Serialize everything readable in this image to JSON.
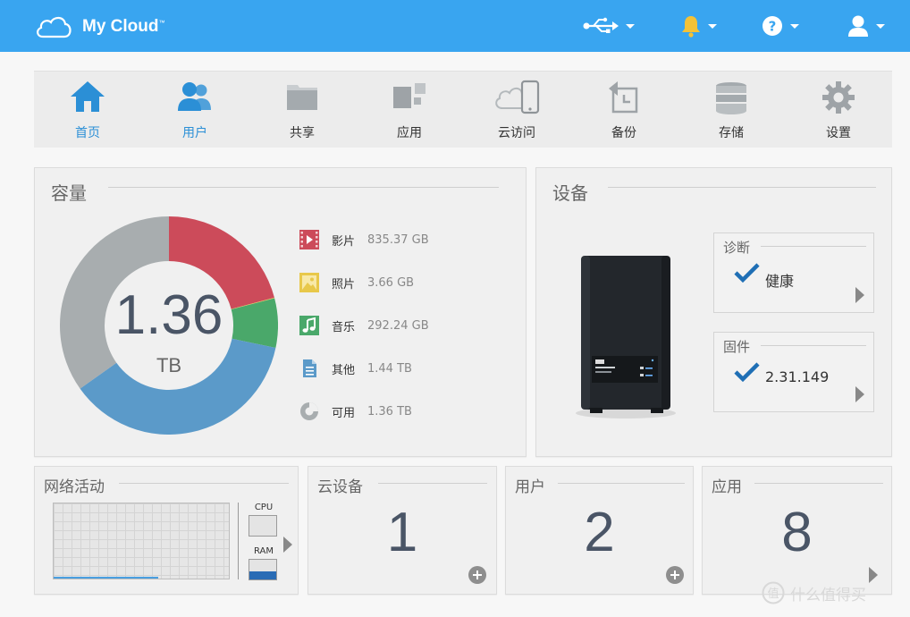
{
  "app": {
    "brand": "My Cloud",
    "trademark": "™"
  },
  "header": {
    "icons": [
      "usb-icon",
      "bell-icon",
      "help-icon",
      "user-icon"
    ],
    "colors": {
      "bar": "#39a5f0",
      "bell": "#f3c237"
    }
  },
  "nav": [
    {
      "label": "首页",
      "icon": "home-icon",
      "active": true
    },
    {
      "label": "用户",
      "icon": "users-icon",
      "active": true
    },
    {
      "label": "共享",
      "icon": "folder-icon",
      "active": false
    },
    {
      "label": "应用",
      "icon": "apps-icon",
      "active": false
    },
    {
      "label": "云访问",
      "icon": "cloud-access-icon",
      "active": false
    },
    {
      "label": "备份",
      "icon": "backup-icon",
      "active": false
    },
    {
      "label": "存储",
      "icon": "storage-icon",
      "active": false
    },
    {
      "label": "设置",
      "icon": "gear-icon",
      "active": false
    }
  ],
  "capacity": {
    "title": "容量",
    "total_value": "1.36",
    "total_unit": "TB",
    "legend": [
      {
        "label": "影片",
        "value": "835.37 GB",
        "icon": "video-icon",
        "color": "#cc4b5a"
      },
      {
        "label": "照片",
        "value": "3.66 GB",
        "icon": "photo-icon",
        "color": "#e8c84a"
      },
      {
        "label": "音乐",
        "value": "292.24 GB",
        "icon": "music-icon",
        "color": "#4aa86a"
      },
      {
        "label": "其他",
        "value": "1.44 TB",
        "icon": "document-icon",
        "color": "#5b9ac9"
      },
      {
        "label": "可用",
        "value": "1.36 TB",
        "icon": "free-space-icon",
        "color": "#a8adaf"
      }
    ]
  },
  "chart_data": {
    "type": "pie",
    "categories": [
      "影片",
      "照片",
      "音乐",
      "其他",
      "可用"
    ],
    "values": [
      835.37,
      3.66,
      292.24,
      1474.56,
      1392.64
    ],
    "colors": [
      "#cc4b5a",
      "#e8c84a",
      "#4aa86a",
      "#5b9ac9",
      "#a8adaf"
    ]
  },
  "device": {
    "title": "设备",
    "diagnostics": {
      "title": "诊断",
      "status": "健康"
    },
    "firmware": {
      "title": "固件",
      "version": "2.31.149"
    }
  },
  "network": {
    "title": "网络活动",
    "cpu_label": "CPU",
    "ram_label": "RAM",
    "ram_usage": 0.4
  },
  "cloud_devices": {
    "title": "云设备",
    "count": "1"
  },
  "users": {
    "title": "用户",
    "count": "2"
  },
  "apps": {
    "title": "应用",
    "count": "8"
  },
  "watermark": "什么值得买"
}
